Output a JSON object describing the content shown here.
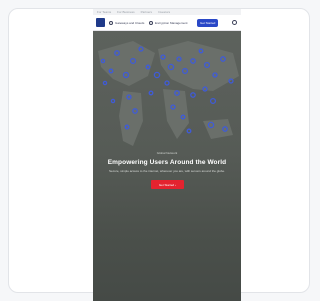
{
  "top_bar": {
    "links": [
      "For Teams",
      "For Business",
      "Partners",
      "Investors"
    ]
  },
  "nav": {
    "item1_label": "Gateways and Clouds",
    "item2_label": "Encryption Management",
    "cta_label": "Get Started"
  },
  "hero": {
    "eyebrow": "Global Network",
    "headline": "Empowering Users Around the World",
    "subline": "Secure, simple access to the internet, wherever you are, with servers around the globe.",
    "cta_label": "Get Started"
  },
  "colors": {
    "brand": "#1f3a8a",
    "accent": "#2a48c7",
    "cta": "#e3232f"
  },
  "icons": [
    "logo-icon",
    "search-icon",
    "arrow-right-icon"
  ]
}
